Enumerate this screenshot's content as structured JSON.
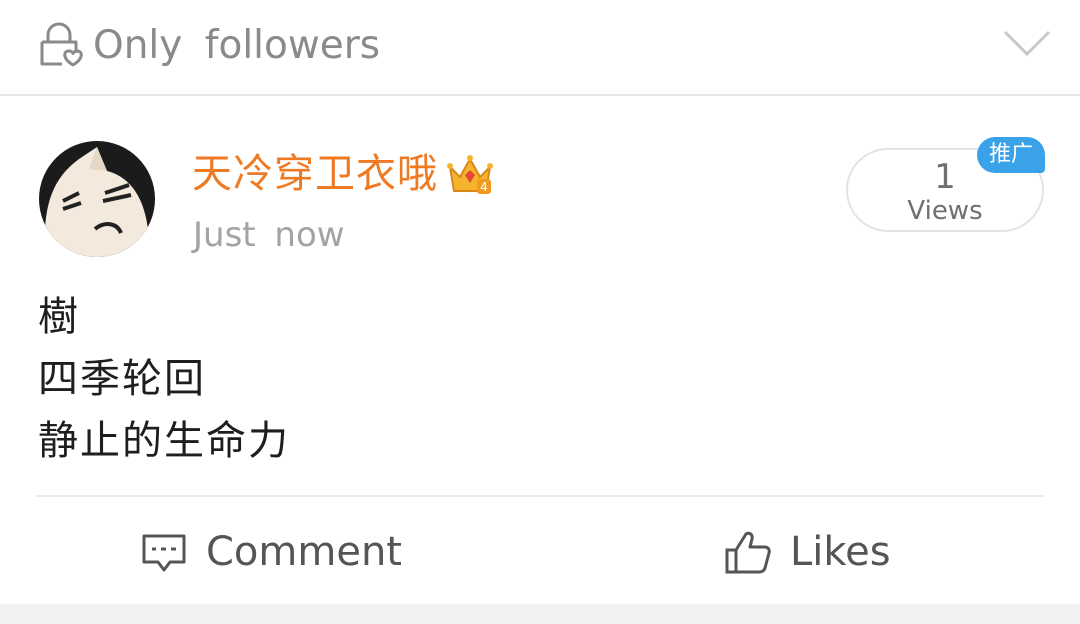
{
  "privacy": {
    "label": "Only  followers",
    "lock_icon": "lock-heart-icon",
    "dropdown_icon": "chevron-down-icon"
  },
  "post": {
    "author": {
      "name": "天冷穿卫衣哦",
      "badge_icon": "crown-vip-icon",
      "badge_level": "4"
    },
    "timestamp": "Just  now",
    "views": {
      "count": "1",
      "label": "Views",
      "promo_badge": "推广"
    },
    "body_lines": [
      "樹",
      "四季轮回",
      "静止的生命力"
    ]
  },
  "actions": {
    "comment_label": "Comment",
    "like_label": "Likes"
  },
  "colors": {
    "username": "#ef7a24",
    "promo_badge": "#3aa2e8",
    "muted_text": "#8a8a8a",
    "divider": "#ececec"
  }
}
